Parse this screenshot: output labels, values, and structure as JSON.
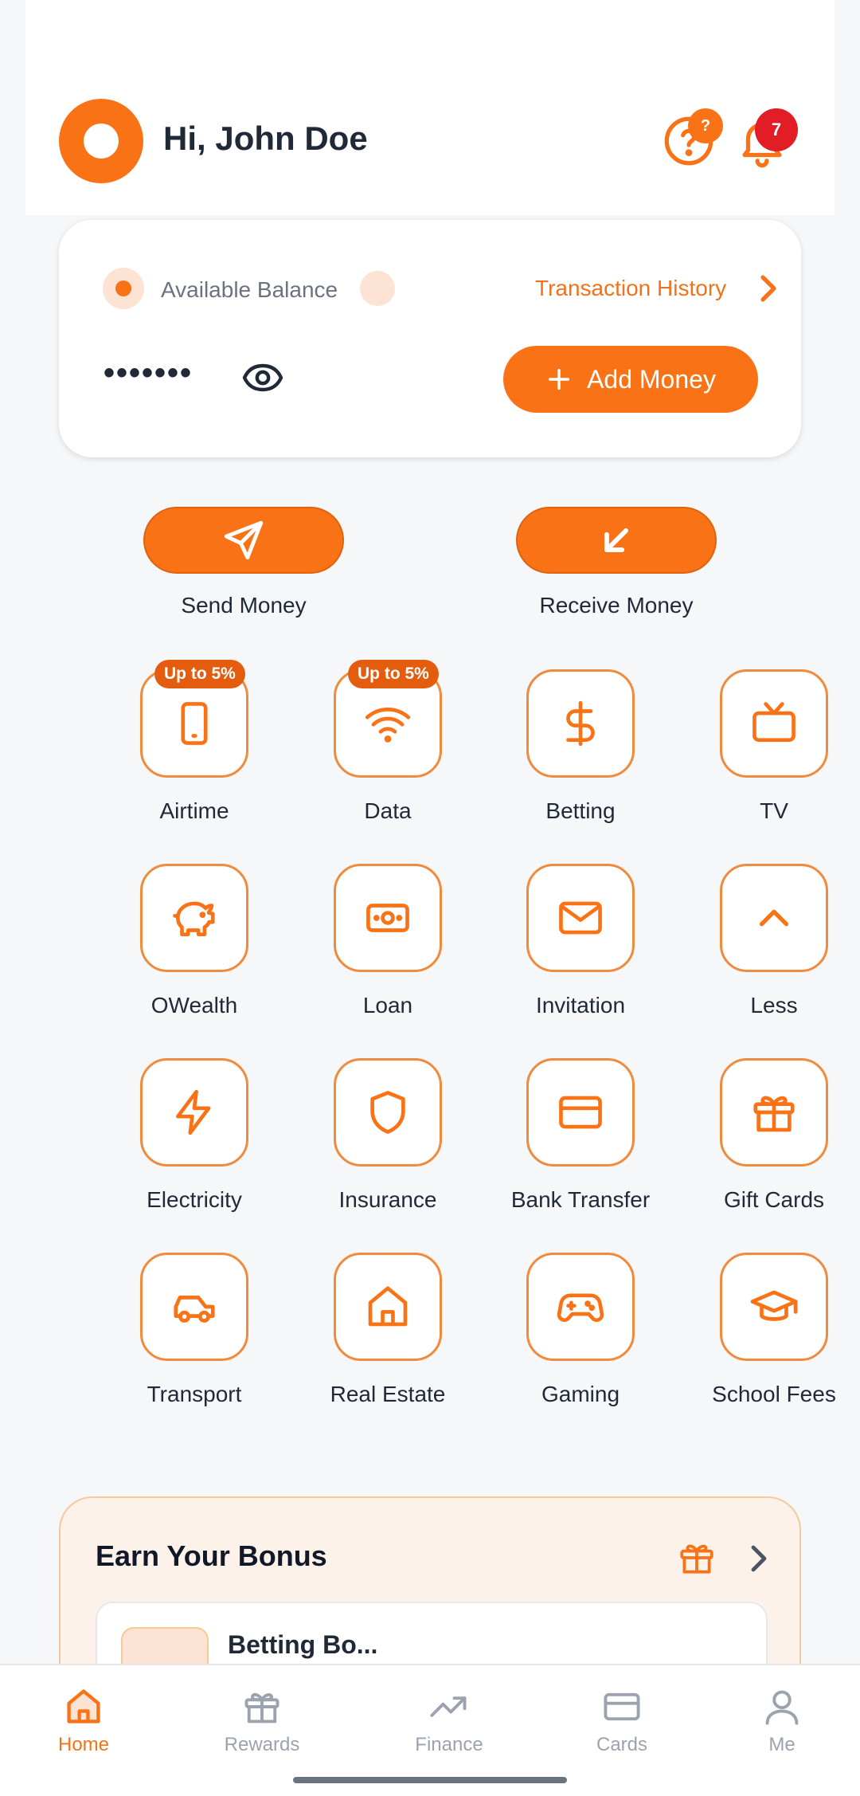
{
  "colors": {
    "accent": "#f97316",
    "notification": "#e11d26",
    "text": "#1f2937",
    "muted": "#9ca3af"
  },
  "header": {
    "greeting": "Hi, John Doe",
    "help_badge": "?",
    "notification_count": "7"
  },
  "balance": {
    "label": "Available Balance",
    "masked_value": "•••••••",
    "history_link": "Transaction History",
    "add_money_label": "Add Money"
  },
  "actions": {
    "send": "Send Money",
    "receive": "Receive Money"
  },
  "services": [
    {
      "label": "Airtime",
      "icon": "phone-icon",
      "promo": "Up to 5%"
    },
    {
      "label": "Data",
      "icon": "wifi-icon",
      "promo": "Up to 5%"
    },
    {
      "label": "Betting",
      "icon": "dollar-icon"
    },
    {
      "label": "TV",
      "icon": "tv-icon"
    },
    {
      "label": "OWealth",
      "icon": "piggy-bank-icon"
    },
    {
      "label": "Loan",
      "icon": "cash-icon"
    },
    {
      "label": "Invitation",
      "icon": "mail-icon"
    },
    {
      "label": "Less",
      "icon": "chevron-up-icon"
    },
    {
      "label": "Electricity",
      "icon": "lightning-icon"
    },
    {
      "label": "Insurance",
      "icon": "shield-icon"
    },
    {
      "label": "Bank Transfer",
      "icon": "card-icon"
    },
    {
      "label": "Gift Cards",
      "icon": "gift-icon"
    },
    {
      "label": "Transport",
      "icon": "car-icon"
    },
    {
      "label": "Real Estate",
      "icon": "house-icon"
    },
    {
      "label": "Gaming",
      "icon": "gamepad-icon"
    },
    {
      "label": "School Fees",
      "icon": "graduation-cap-icon"
    }
  ],
  "bonus": {
    "title": "Earn Your Bonus",
    "first_item": "Betting Bo..."
  },
  "tabs": [
    {
      "label": "Home",
      "icon": "home-icon",
      "active": true
    },
    {
      "label": "Rewards",
      "icon": "gift-icon"
    },
    {
      "label": "Finance",
      "icon": "trending-up-icon"
    },
    {
      "label": "Cards",
      "icon": "card-icon"
    },
    {
      "label": "Me",
      "icon": "user-icon"
    }
  ]
}
